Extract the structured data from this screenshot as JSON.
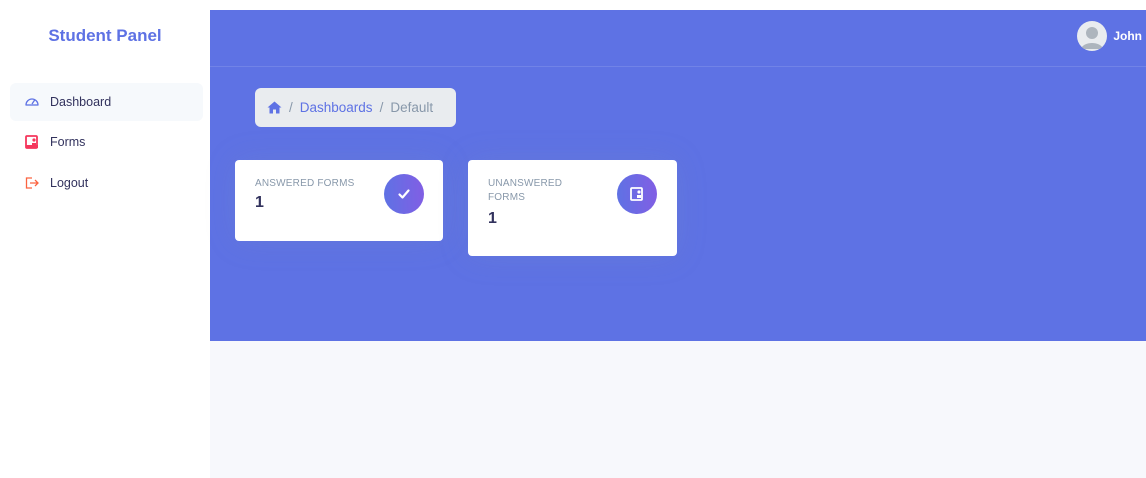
{
  "sidebar": {
    "brand": "Student Panel",
    "items": [
      {
        "label": "Dashboard",
        "icon": "dashboard-gauge-icon",
        "active": true
      },
      {
        "label": "Forms",
        "icon": "forms-icon",
        "active": false
      },
      {
        "label": "Logout",
        "icon": "logout-icon",
        "active": false
      }
    ]
  },
  "header": {
    "user_name": "John"
  },
  "breadcrumb": {
    "home_icon": "home-icon",
    "items": [
      "Dashboards",
      "Default"
    ]
  },
  "stats": [
    {
      "title": "ANSWERED FORMS",
      "value": "1",
      "icon": "check-icon"
    },
    {
      "title": "UNANSWERED FORMS",
      "value": "1",
      "icon": "form-icon"
    }
  ],
  "colors": {
    "primary": "#5e72e4",
    "forms_icon": "#f5365c",
    "background_lower": "#f7f8fc"
  }
}
